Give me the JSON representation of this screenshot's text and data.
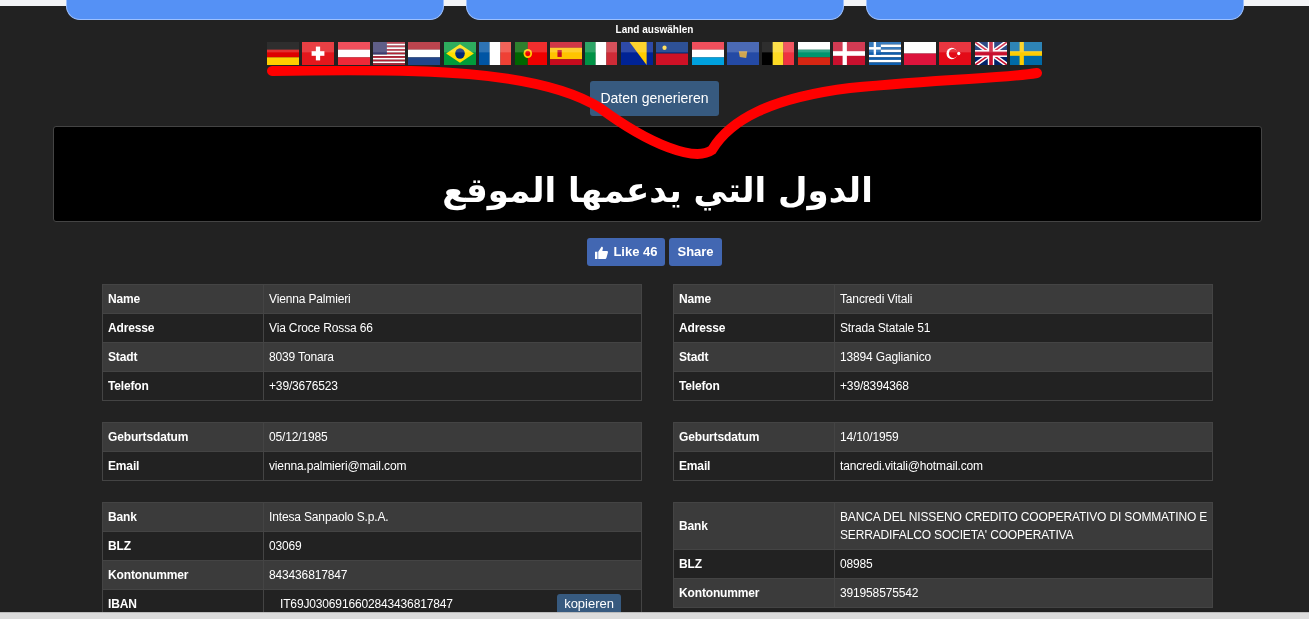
{
  "country_picker": {
    "label": "Land auswählen",
    "flags": [
      {
        "kind": "de"
      },
      {
        "kind": "ch"
      },
      {
        "kind": "at"
      },
      {
        "kind": "us"
      },
      {
        "kind": "nl"
      },
      {
        "kind": "br"
      },
      {
        "kind": "fr"
      },
      {
        "kind": "pt"
      },
      {
        "kind": "es"
      },
      {
        "kind": "it"
      },
      {
        "kind": "ba"
      },
      {
        "kind": "li"
      },
      {
        "kind": "lu"
      },
      {
        "kind": "xk"
      },
      {
        "kind": "be"
      },
      {
        "kind": "bg"
      },
      {
        "kind": "dk"
      },
      {
        "kind": "gr"
      },
      {
        "kind": "pl"
      },
      {
        "kind": "tr"
      },
      {
        "kind": "gb"
      },
      {
        "kind": "se"
      }
    ]
  },
  "generate_button": "Daten generieren",
  "banner": {
    "text": "الدول التي يدعمها الموقع"
  },
  "social": {
    "like": "Like 46",
    "share": "Share"
  },
  "people": [
    {
      "groups": [
        [
          {
            "label": "Name",
            "value": "Vienna Palmieri"
          },
          {
            "label": "Adresse",
            "value": "Via Croce Rossa 66"
          },
          {
            "label": "Stadt",
            "value": "8039 Tonara"
          },
          {
            "label": "Telefon",
            "value": "+39/3676523"
          }
        ],
        [
          {
            "label": "Geburtsdatum",
            "value": "05/12/1985"
          },
          {
            "label": "Email",
            "value": "vienna.palmieri@mail.com"
          }
        ],
        [
          {
            "label": "Bank",
            "value": "Intesa Sanpaolo S.p.A."
          },
          {
            "label": "BLZ",
            "value": "03069"
          },
          {
            "label": "Kontonummer",
            "value": "843436817847"
          },
          {
            "label": "IBAN",
            "value": "IT69J0306916602843436817847",
            "button": "kopieren"
          }
        ]
      ]
    },
    {
      "groups": [
        [
          {
            "label": "Name",
            "value": "Tancredi Vitali"
          },
          {
            "label": "Adresse",
            "value": "Strada Statale 51"
          },
          {
            "label": "Stadt",
            "value": "13894 Gaglianico"
          },
          {
            "label": "Telefon",
            "value": "+39/8394368"
          }
        ],
        [
          {
            "label": "Geburtsdatum",
            "value": "14/10/1959"
          },
          {
            "label": "Email",
            "value": "tancredi.vitali@hotmail.com"
          }
        ],
        [
          {
            "label": "Bank",
            "value": "BANCA DEL NISSENO CREDITO COOPERATIVO DI SOMMATINO E SERRADIFALCO SOCIETA' COOPERATIVA"
          },
          {
            "label": "BLZ",
            "value": "08985"
          },
          {
            "label": "Kontonummer",
            "value": "391958575542"
          }
        ]
      ]
    }
  ]
}
